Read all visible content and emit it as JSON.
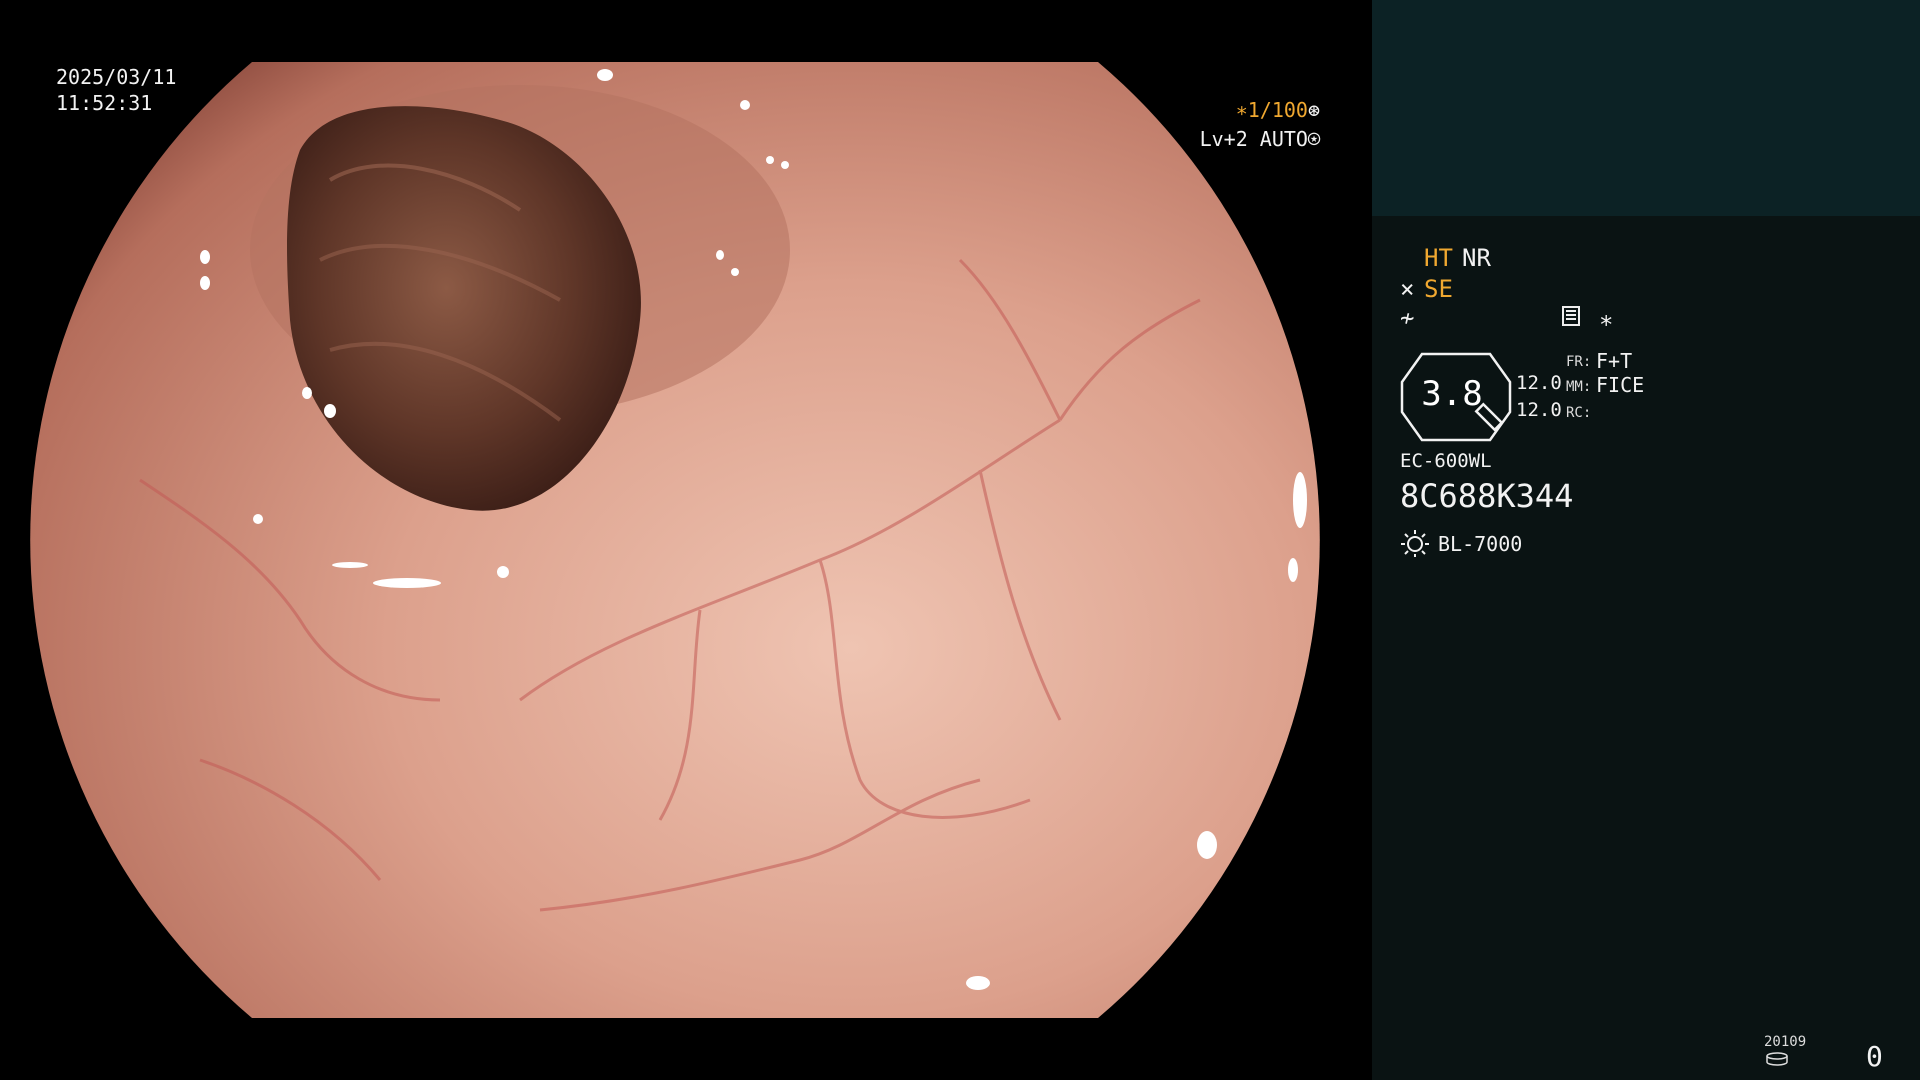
{
  "overlay": {
    "date": "2025/03/11",
    "time": "11:52:31",
    "shutter": "∗1/100",
    "shutter_icon": "aperture-icon",
    "brightness": "Lv+2 AUTO",
    "brightness_icon": "iris-icon"
  },
  "panel": {
    "ht": "HT",
    "nr": "NR",
    "se": "SE",
    "star": "∗",
    "zoom": "3.8",
    "value1": "12.0",
    "value2": "12.0",
    "fr_label": "FR:",
    "fr_value": "F+T",
    "mm_label": "MM:",
    "mm_value": "FICE",
    "rc_label": "RC:",
    "scope_model": "EC-600WL",
    "serial": "8C688K344",
    "light_source": "BL-7000",
    "counter_label": "20109",
    "counter_value": "0"
  },
  "colors": {
    "accent": "#f0a830",
    "panel_bg": "#0a1313",
    "panel_top": "#0c2225",
    "mucosa": "#d89a86"
  }
}
